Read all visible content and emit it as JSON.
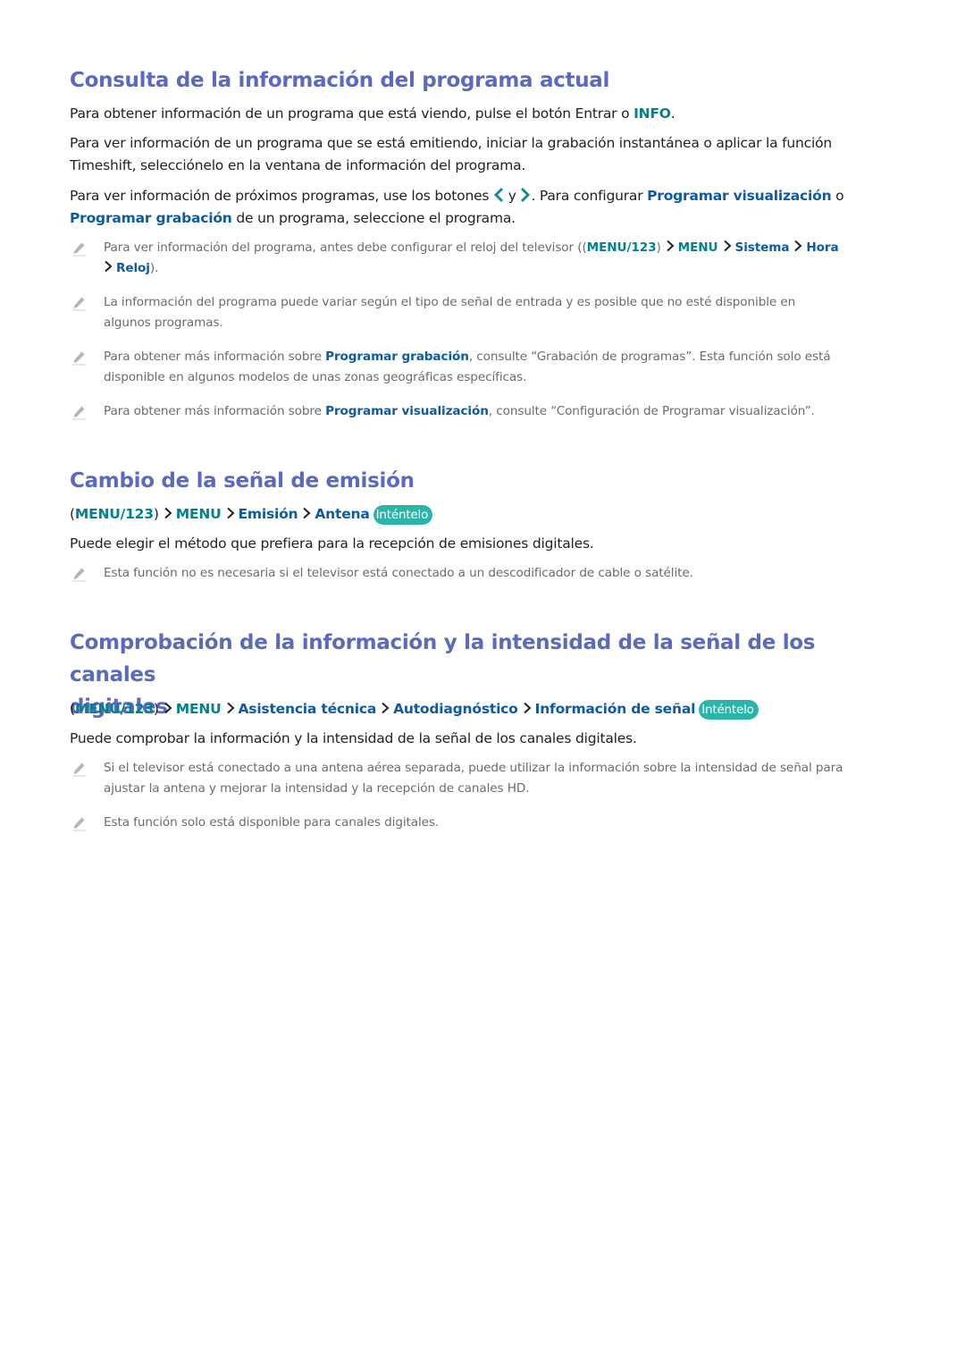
{
  "colors": {
    "heading": "#5b6abf",
    "teal_link": "#00838f",
    "blue_link": "#0d5aa7",
    "body_text": "#222222",
    "note_text": "#6b6b6b",
    "try_badge": "#2bb5a9"
  },
  "section1": {
    "title": "Consulta de la información del programa actual",
    "p1": {
      "before": "Para obtener información de un programa que está viendo, pulse el botón Entrar o ",
      "info": "INFO",
      "after": "."
    },
    "p2": {
      "line1": "Para ver información de un programa que se está emitiendo, iniciar la grabación instantánea o aplicar la función",
      "line2": "Timeshift, selecciónelo en la ventana de información del programa."
    },
    "p3": {
      "before": "Para ver información de próximos programas, use los botones ",
      "left_icon": "chevron-left-icon",
      "middle": " y ",
      "right_icon": "chevron-right-icon",
      "after": ". Para configurar ",
      "link1": "Programar visualización",
      "conj": " o",
      "link2": "Programar grabación",
      "end": " de un programa, seleccione el programa."
    },
    "notes": [
      {
        "before": "Para ver información del programa, antes debe configurar el reloj del televisor ((",
        "menu123": "MENU/123",
        "close": ")",
        "menu": "MENU",
        "sistema": "Sistema",
        "hora": "Hora",
        "reloj": "Reloj",
        "after": ")."
      },
      {
        "line1": "La información del programa puede variar según el tipo de señal de entrada y es posible que no esté disponible en",
        "line2": "algunos programas."
      },
      {
        "before": "Para obtener más información sobre ",
        "link": "Programar grabación",
        "after": ", consulte “Grabación de programas”. Esta función solo está",
        "line2": "disponible en algunos modelos de unas zonas geográficas específicas."
      },
      {
        "before": "Para obtener más información sobre ",
        "link": "Programar visualización",
        "after": ", consulte “Configuración de Programar visualización”."
      }
    ]
  },
  "section2": {
    "title": "Cambio de la señal de emisión",
    "path": {
      "open": "(",
      "menu123": "MENU/123",
      "close": ")",
      "menu": "MENU",
      "item1": "Emisión",
      "item2": "Antena",
      "try": "Inténtelo"
    },
    "p1": "Puede elegir el método que prefiera para la recepción de emisiones digitales.",
    "notes": [
      {
        "text": "Esta función no es necesaria si el televisor está conectado a un descodificador de cable o satélite."
      }
    ]
  },
  "section3": {
    "title_line1": "Comprobación de la información y la intensidad de la señal de los canales",
    "title_line2": "digitales",
    "path": {
      "open": "(",
      "menu123": "MENU/123",
      "close": ")",
      "menu": "MENU",
      "item1": "Asistencia técnica",
      "item2": "Autodiagnóstico",
      "item3": "Información de señal",
      "try": "Inténtelo"
    },
    "p1": "Puede comprobar la información y la intensidad de la señal de los canales digitales.",
    "notes": [
      {
        "line1": "Si el televisor está conectado a una antena aérea separada, puede utilizar la información sobre la intensidad de señal para",
        "line2": "ajustar la antena y mejorar la intensidad y la recepción de canales HD."
      },
      {
        "text": "Esta función solo está disponible para canales digitales."
      }
    ]
  }
}
